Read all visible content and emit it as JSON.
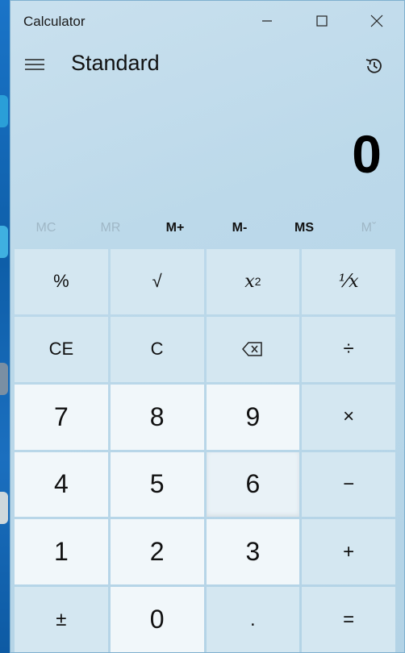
{
  "window": {
    "title": "Calculator"
  },
  "header": {
    "mode": "Standard"
  },
  "display": {
    "value": "0"
  },
  "memory": [
    {
      "label": "MC",
      "enabled": false
    },
    {
      "label": "MR",
      "enabled": false
    },
    {
      "label": "M+",
      "enabled": true
    },
    {
      "label": "M-",
      "enabled": true
    },
    {
      "label": "MS",
      "enabled": true
    },
    {
      "label": "Mˇ",
      "enabled": false
    }
  ],
  "keys": {
    "percent": "%",
    "sqrt": "√",
    "square_base": "x",
    "square_exp": "2",
    "reciprocal": "⅟x",
    "ce": "CE",
    "c": "C",
    "divide": "÷",
    "seven": "7",
    "eight": "8",
    "nine": "9",
    "multiply": "×",
    "four": "4",
    "five": "5",
    "six": "6",
    "minus": "−",
    "one": "1",
    "two": "2",
    "three": "3",
    "plus": "+",
    "negate": "±",
    "zero": "0",
    "decimal": ".",
    "equals": "="
  },
  "colors": {
    "window_bg": "#c9e0ee",
    "number_key": "#f1f7fa",
    "operator_key": "#d4e7f1",
    "desktop": "#0f6cbd"
  }
}
